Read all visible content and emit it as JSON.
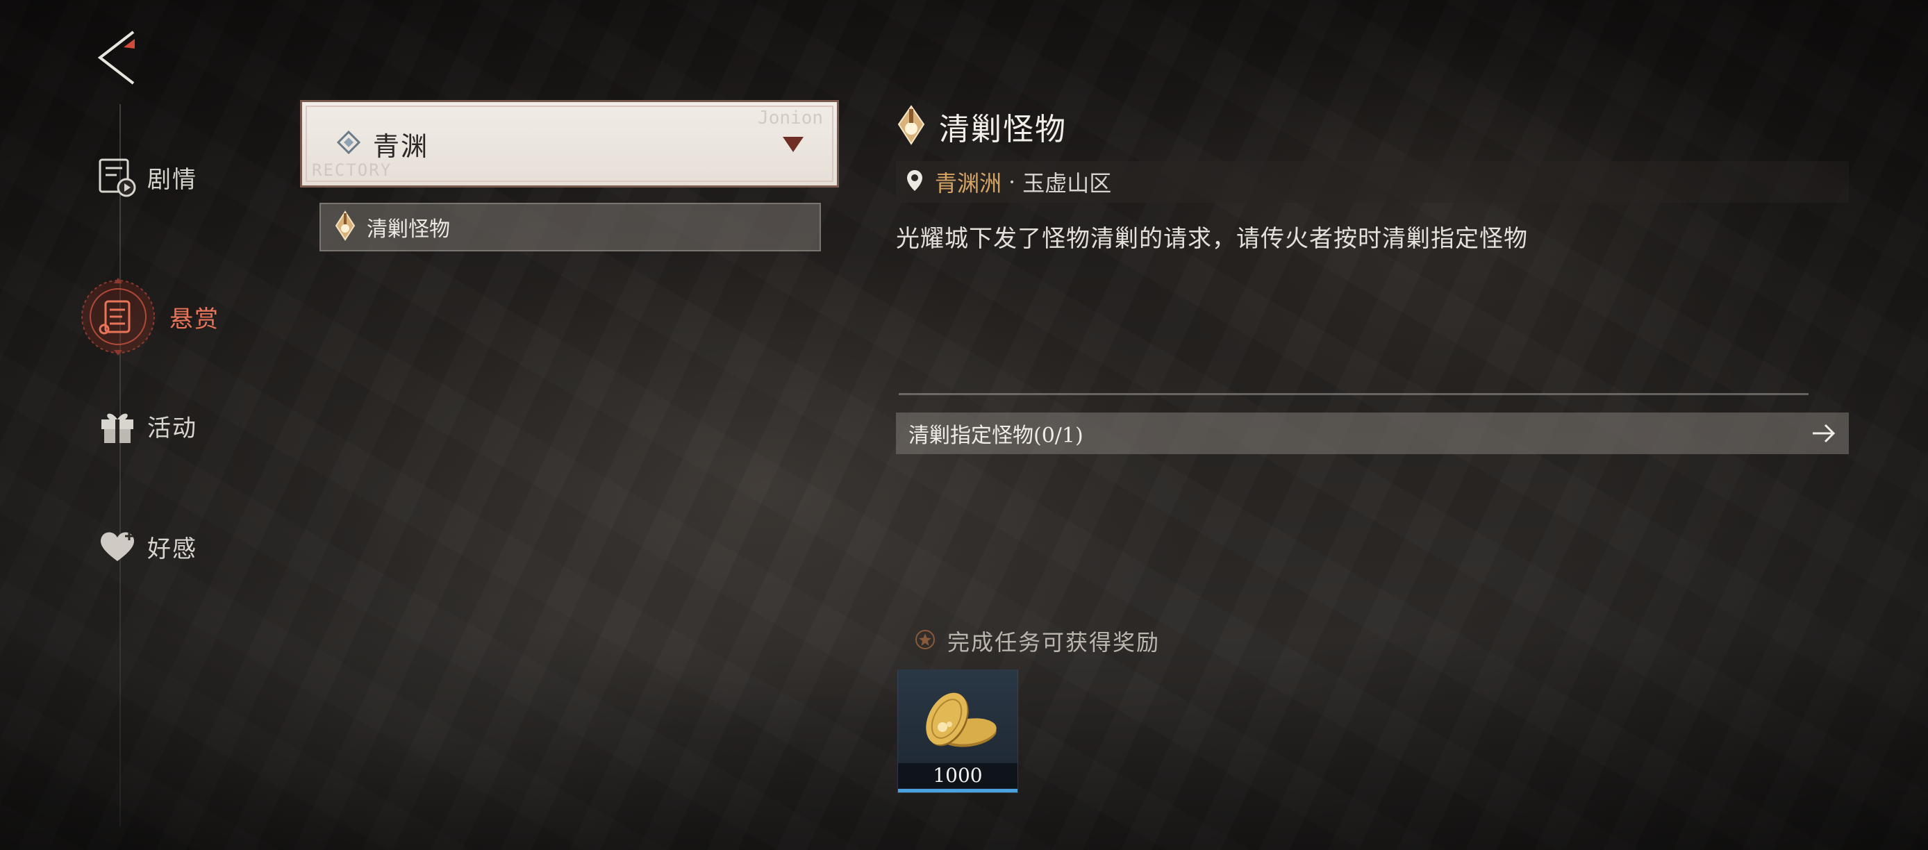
{
  "sidebar": {
    "items": [
      {
        "label": "剧情",
        "icon": "story-icon"
      },
      {
        "label": "悬赏",
        "icon": "bounty-scroll-icon",
        "active": true
      },
      {
        "label": "活动",
        "icon": "gift-icon"
      },
      {
        "label": "好感",
        "icon": "heart-icon"
      }
    ]
  },
  "region_select": {
    "selected": "青渊",
    "stamp_top": "Jonion",
    "stamp_bottom": "RECTORY"
  },
  "quest_list": {
    "items": [
      {
        "label": "清剿怪物"
      }
    ]
  },
  "detail": {
    "title": "清剿怪物",
    "region": "青渊洲",
    "separator": "·",
    "area": "玉虚山区",
    "description": "光耀城下发了怪物清剿的请求，请传火者按时清剿指定怪物",
    "objective": "清剿指定怪物(0/1)"
  },
  "rewards": {
    "header": "完成任务可获得奖励",
    "items": [
      {
        "name": "gold-coin-icon",
        "quantity": "1000"
      }
    ]
  },
  "colors": {
    "accent_active": "#e8745a",
    "region_gold": "#d6a566",
    "reward_bar": "#4aa3e0"
  }
}
